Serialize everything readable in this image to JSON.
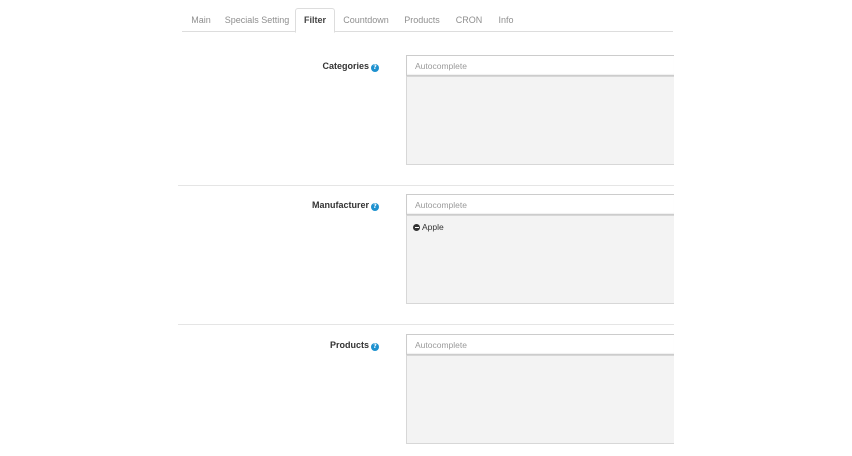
{
  "tabs": [
    {
      "label": "Main",
      "active": false
    },
    {
      "label": "Specials Setting",
      "active": false
    },
    {
      "label": "Filter",
      "active": true
    },
    {
      "label": "Countdown",
      "active": false
    },
    {
      "label": "Products",
      "active": false
    },
    {
      "label": "CRON",
      "active": false
    },
    {
      "label": "Info",
      "active": false
    }
  ],
  "fields": {
    "categories": {
      "label": "Categories",
      "help_icon": "question-circle-icon",
      "placeholder": "Autocomplete",
      "value": "",
      "selected": []
    },
    "manufacturer": {
      "label": "Manufacturer",
      "help_icon": "question-circle-icon",
      "placeholder": "Autocomplete",
      "value": "",
      "selected": [
        {
          "name": "Apple",
          "remove_icon": "minus-circle-icon"
        }
      ]
    },
    "products": {
      "label": "Products",
      "help_icon": "question-circle-icon",
      "placeholder": "Autocomplete",
      "value": "",
      "selected": []
    }
  },
  "colors": {
    "help_icon": "#1e91cf",
    "well_background": "#f3f3f3",
    "tab_border": "#dddddd"
  }
}
